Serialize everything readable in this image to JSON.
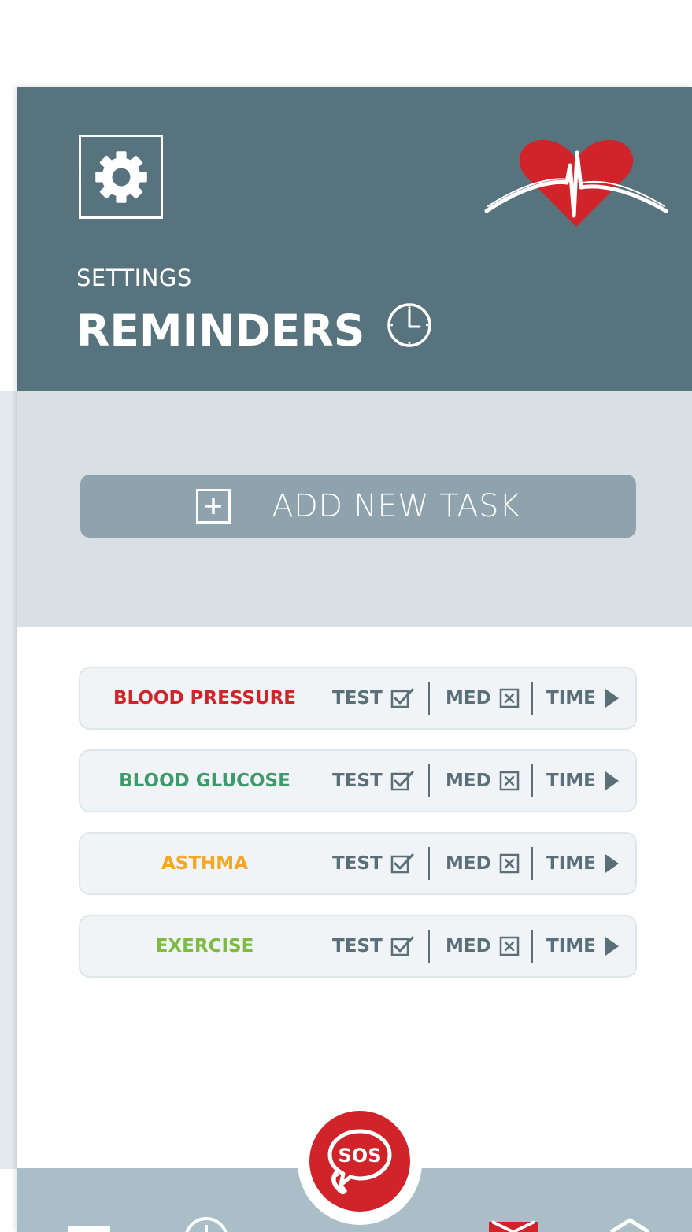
{
  "header": {
    "section": "SETTINGS",
    "title": "REMINDERS"
  },
  "add_task": {
    "label": "ADD NEW TASK"
  },
  "tasks": [
    {
      "name": "BLOOD PRESSURE",
      "color": "#d1232a",
      "test": "TEST",
      "med": "MED",
      "time": "TIME"
    },
    {
      "name": "BLOOD GLUCOSE",
      "color": "#3f9a6b",
      "test": "TEST",
      "med": "MED",
      "time": "TIME"
    },
    {
      "name": "ASTHMA",
      "color": "#f5a623",
      "test": "TEST",
      "med": "MED",
      "time": "TIME"
    },
    {
      "name": "EXERCISE",
      "color": "#7dbb42",
      "test": "TEST",
      "med": "MED",
      "time": "TIME"
    }
  ],
  "sos": {
    "label": "SOS"
  },
  "colors": {
    "header_bg": "#56737e",
    "add_area_bg": "#d8e0e4",
    "add_button_bg": "#8fa3ae",
    "nav_bg": "#a9bec7",
    "accent_red": "#d1232a",
    "segment_text": "#5a6f78"
  },
  "icons": {
    "settings": "gear-icon",
    "logo": "heart-logo",
    "title": "clock-icon",
    "add": "plus-box-icon",
    "test": "checkbox-checked-icon",
    "med": "checkbox-x-icon",
    "time": "play-arrow-icon",
    "sos": "sos-phone-icon"
  }
}
